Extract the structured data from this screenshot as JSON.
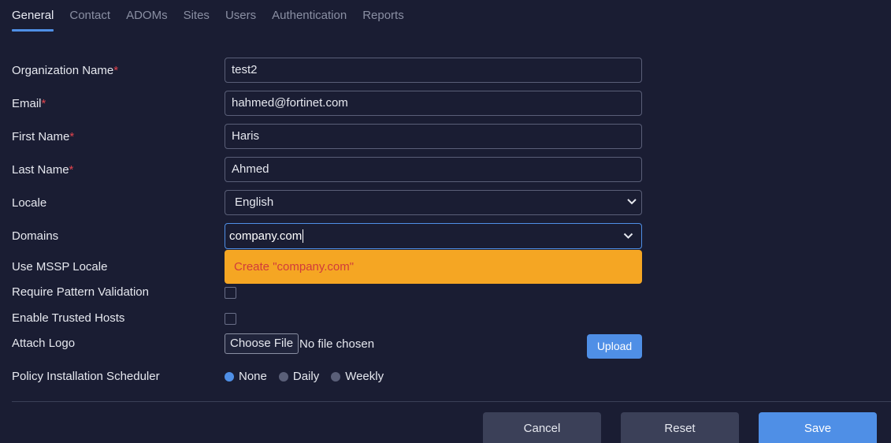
{
  "tabs": [
    {
      "label": "General",
      "active": true
    },
    {
      "label": "Contact"
    },
    {
      "label": "ADOMs"
    },
    {
      "label": "Sites"
    },
    {
      "label": "Users"
    },
    {
      "label": "Authentication"
    },
    {
      "label": "Reports"
    }
  ],
  "form": {
    "org_name": {
      "label": "Organization Name",
      "required_mark": "*",
      "value": "test2"
    },
    "email": {
      "label": "Email",
      "required_mark": "*",
      "value": "hahmed@fortinet.com"
    },
    "first_name": {
      "label": "First Name",
      "required_mark": "*",
      "value": "Haris"
    },
    "last_name": {
      "label": "Last Name",
      "required_mark": "*",
      "value": "Ahmed"
    },
    "locale": {
      "label": "Locale",
      "value": "English"
    },
    "domains": {
      "label": "Domains",
      "value": "company.com",
      "dropdown_option": "Create \"company.com\""
    },
    "use_mssp_locale": {
      "label": "Use MSSP Locale"
    },
    "require_pattern": {
      "label": "Require Pattern Validation",
      "checked": false
    },
    "trusted_hosts": {
      "label": "Enable Trusted Hosts",
      "checked": false
    },
    "attach_logo": {
      "label": "Attach Logo",
      "choose_file_label": "Choose File",
      "file_status": "No file chosen",
      "upload_label": "Upload"
    },
    "scheduler": {
      "label": "Policy Installation Scheduler",
      "options": [
        {
          "label": "None",
          "selected": true
        },
        {
          "label": "Daily",
          "selected": false
        },
        {
          "label": "Weekly",
          "selected": false
        }
      ]
    }
  },
  "footer": {
    "cancel_label": "Cancel",
    "reset_label": "Reset",
    "save_label": "Save"
  },
  "colors": {
    "background": "#1a1d33",
    "accent": "#4f8fe6",
    "required": "#e0434c",
    "dropdown_highlight": "#f5a623"
  }
}
